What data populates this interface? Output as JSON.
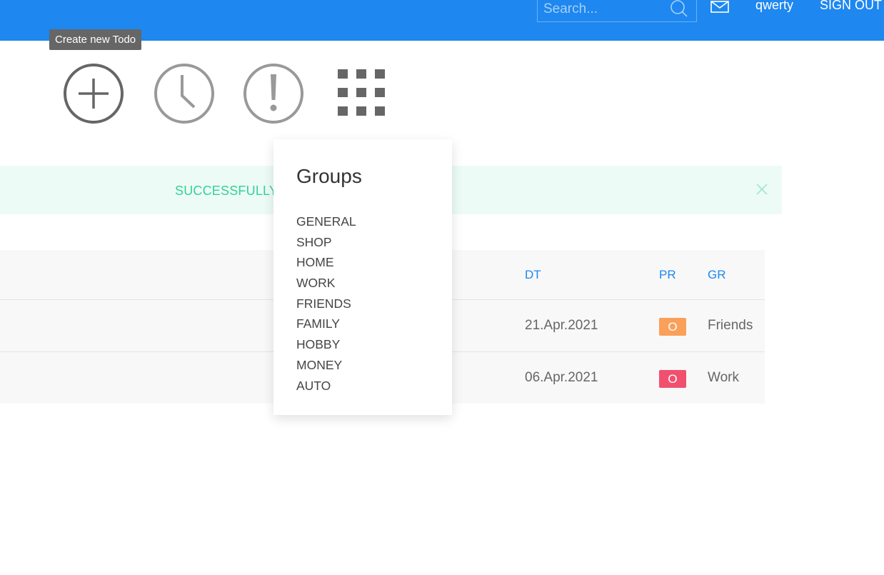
{
  "header": {
    "search_placeholder": "Search...",
    "username": "qwerty",
    "signout_label": "SIGN OUT"
  },
  "tooltip": {
    "text": "Create new Todo"
  },
  "toolbar": {
    "icons": [
      "plus-circle-icon",
      "clock-icon",
      "exclamation-circle-icon",
      "grid-icon"
    ]
  },
  "alert": {
    "text": "SUCCESSFULLY"
  },
  "table": {
    "headers": {
      "dt": "DT",
      "pr": "PR",
      "gr": "GR"
    },
    "rows": [
      {
        "date": "21.Apr.2021",
        "priority": "O",
        "priority_color": "#faa05a",
        "group": "Friends"
      },
      {
        "date": "06.Apr.2021",
        "priority": "O",
        "priority_color": "#f0506e",
        "group": "Work"
      }
    ]
  },
  "groups_dropdown": {
    "title": "Groups",
    "items": [
      "GENERAL",
      "SHOP",
      "HOME",
      "WORK",
      "FRIENDS",
      "FAMILY",
      "HOBBY",
      "MONEY",
      "AUTO"
    ]
  },
  "colors": {
    "primary": "#1e87f0",
    "success": "#32d296",
    "warning": "#faa05a",
    "danger": "#f0506e"
  }
}
